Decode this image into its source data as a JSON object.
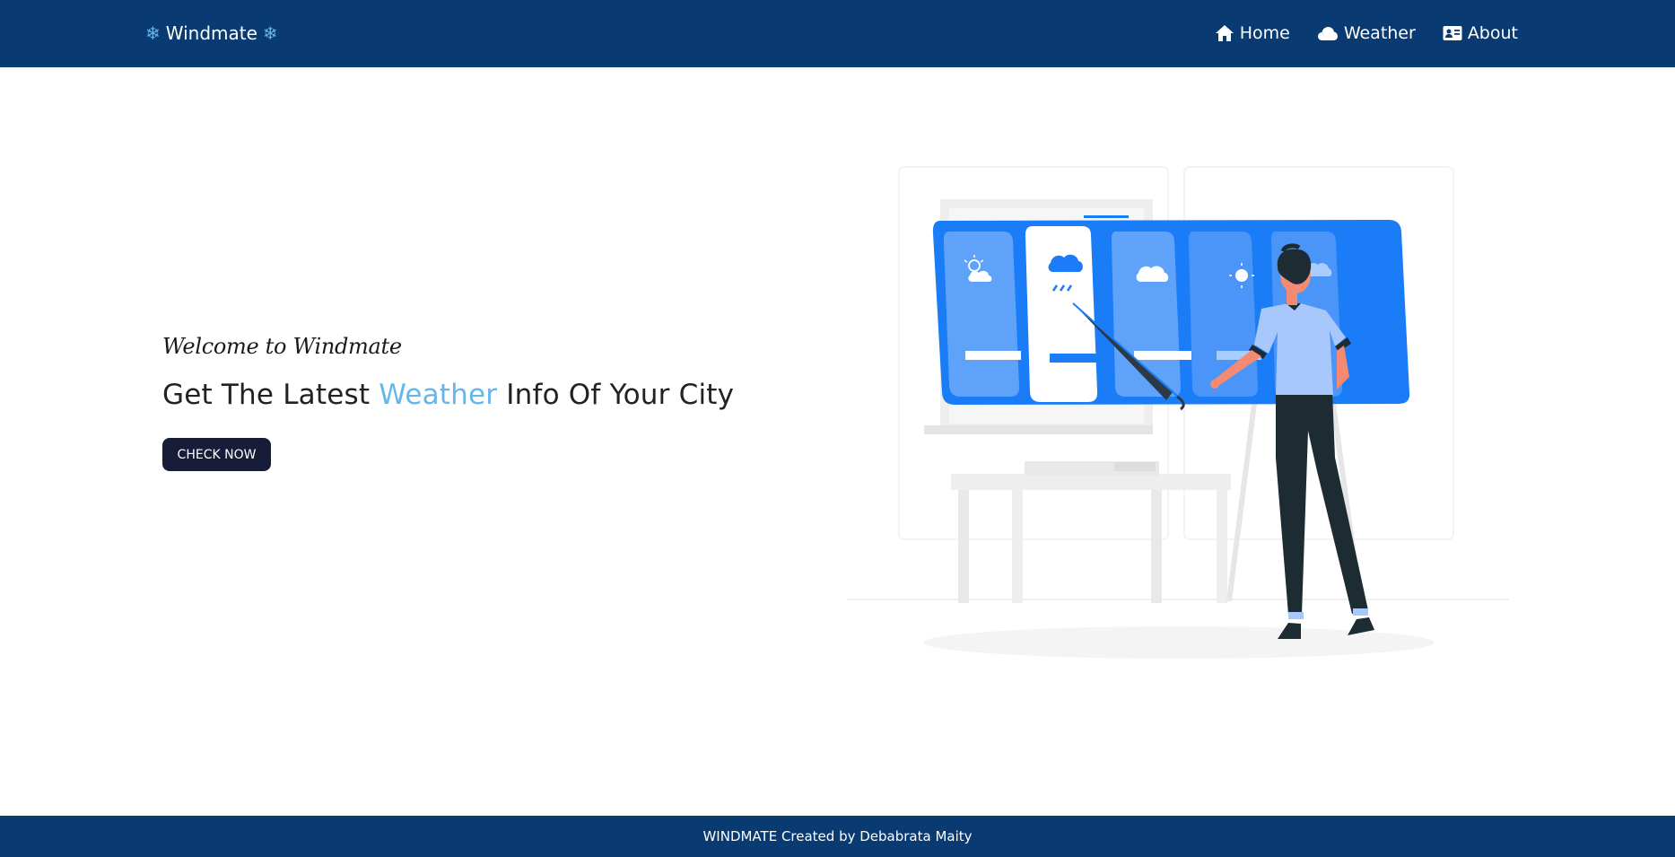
{
  "navbar": {
    "brand_left_icon": "❄",
    "brand_text": "Windmate",
    "brand_right_icon": "❄",
    "links": [
      {
        "label": "Home",
        "icon": "home-icon"
      },
      {
        "label": "Weather",
        "icon": "cloud-icon"
      },
      {
        "label": "About",
        "icon": "id-card-icon"
      }
    ]
  },
  "hero": {
    "welcome": "Welcome to Windmate",
    "headline_before": "Get The Latest ",
    "headline_accent": "Weather",
    "headline_after": " Info Of Your City",
    "button_label": "CHECK NOW"
  },
  "footer": {
    "text": "WINDMATE Created by Debabrata Maity"
  },
  "colors": {
    "navbar_bg": "#093a72",
    "accent": "#67b6ea",
    "button_bg": "#171c38",
    "panel_blue": "#1a7cf7"
  }
}
